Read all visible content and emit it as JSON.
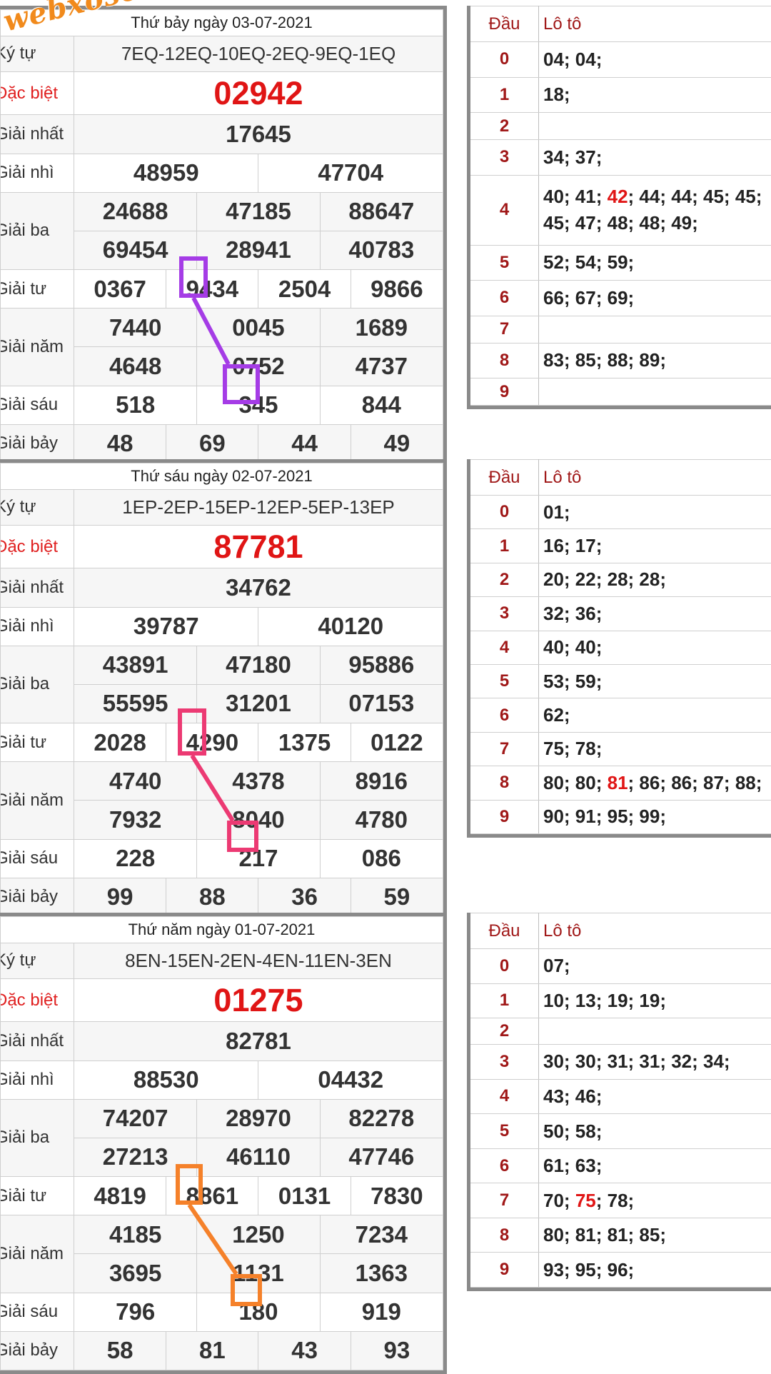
{
  "watermark": "webxoso.net",
  "labels": {
    "ky_tu": "Ký tự",
    "dac_biet": "Đặc biệt",
    "nhat": "Giải nhất",
    "nhi": "Giải nhì",
    "ba": "Giải ba",
    "tu": "Giải tư",
    "nam": "Giải năm",
    "sau": "Giải sáu",
    "bay": "Giải bảy",
    "dau": "Đầu",
    "loto": "Lô tô"
  },
  "draws": [
    {
      "title": "Thứ bảy ngày 03-07-2021",
      "code": "7EQ-12EQ-10EQ-2EQ-9EQ-1EQ",
      "special": "02942",
      "nhat": "17645",
      "nhi": [
        "48959",
        "47704"
      ],
      "ba": [
        "24688",
        "47185",
        "88647",
        "69454",
        "28941",
        "40783"
      ],
      "tu": [
        "0367",
        "9434",
        "2504",
        "9866"
      ],
      "nam": [
        "7440",
        "0045",
        "1689",
        "4648",
        "0752",
        "4737"
      ],
      "sau": [
        "518",
        "345",
        "844"
      ],
      "bay": [
        "48",
        "69",
        "44",
        "49"
      ],
      "loto": [
        {
          "d": "0",
          "v": "04; 04;"
        },
        {
          "d": "1",
          "v": "18;"
        },
        {
          "d": "2",
          "v": ""
        },
        {
          "d": "3",
          "v": "34; 37;"
        },
        {
          "d": "4",
          "pre": "40; 41; ",
          "hl": "42",
          "post": "; 44; 44; 45; 45; 45; 47; 48; 48; 49;"
        },
        {
          "d": "5",
          "v": "52; 54; 59;"
        },
        {
          "d": "6",
          "v": "66; 67; 69;"
        },
        {
          "d": "7",
          "v": ""
        },
        {
          "d": "8",
          "v": "83; 85; 88; 89;"
        },
        {
          "d": "9",
          "v": ""
        }
      ],
      "mark_color": "#a53ce6"
    },
    {
      "title": "Thứ sáu ngày 02-07-2021",
      "code": "1EP-2EP-15EP-12EP-5EP-13EP",
      "special": "87781",
      "nhat": "34762",
      "nhi": [
        "39787",
        "40120"
      ],
      "ba": [
        "43891",
        "47180",
        "95886",
        "55595",
        "31201",
        "07153"
      ],
      "tu": [
        "2028",
        "4290",
        "1375",
        "0122"
      ],
      "nam": [
        "4740",
        "4378",
        "8916",
        "7932",
        "8040",
        "4780"
      ],
      "sau": [
        "228",
        "217",
        "086"
      ],
      "bay": [
        "99",
        "88",
        "36",
        "59"
      ],
      "loto": [
        {
          "d": "0",
          "v": "01;"
        },
        {
          "d": "1",
          "v": "16; 17;"
        },
        {
          "d": "2",
          "v": "20; 22; 28; 28;"
        },
        {
          "d": "3",
          "v": "32; 36;"
        },
        {
          "d": "4",
          "v": "40; 40;"
        },
        {
          "d": "5",
          "v": "53; 59;"
        },
        {
          "d": "6",
          "v": "62;"
        },
        {
          "d": "7",
          "v": "75; 78;"
        },
        {
          "d": "8",
          "pre": "80; 80; ",
          "hl": "81",
          "post": "; 86; 86; 87; 88;"
        },
        {
          "d": "9",
          "v": "90; 91; 95; 99;"
        }
      ],
      "mark_color": "#ec3a73"
    },
    {
      "title": "Thứ năm ngày 01-07-2021",
      "code": "8EN-15EN-2EN-4EN-11EN-3EN",
      "special": "01275",
      "nhat": "82781",
      "nhi": [
        "88530",
        "04432"
      ],
      "ba": [
        "74207",
        "28970",
        "82278",
        "27213",
        "46110",
        "47746"
      ],
      "tu": [
        "4819",
        "8861",
        "0131",
        "7830"
      ],
      "nam": [
        "4185",
        "1250",
        "7234",
        "3695",
        "1131",
        "1363"
      ],
      "sau": [
        "796",
        "180",
        "919"
      ],
      "bay": [
        "58",
        "81",
        "43",
        "93"
      ],
      "loto": [
        {
          "d": "0",
          "v": "07;"
        },
        {
          "d": "1",
          "v": "10; 13; 19; 19;"
        },
        {
          "d": "2",
          "v": ""
        },
        {
          "d": "3",
          "v": "30; 30; 31; 31; 32; 34;"
        },
        {
          "d": "4",
          "v": "43; 46;"
        },
        {
          "d": "5",
          "v": "50; 58;"
        },
        {
          "d": "6",
          "v": "61; 63;"
        },
        {
          "d": "7",
          "pre": "70; ",
          "hl": "75",
          "post": "; 78;"
        },
        {
          "d": "8",
          "v": "80; 81; 81; 85;"
        },
        {
          "d": "9",
          "v": "93; 95; 96;"
        }
      ],
      "mark_color": "#f5812a"
    }
  ]
}
